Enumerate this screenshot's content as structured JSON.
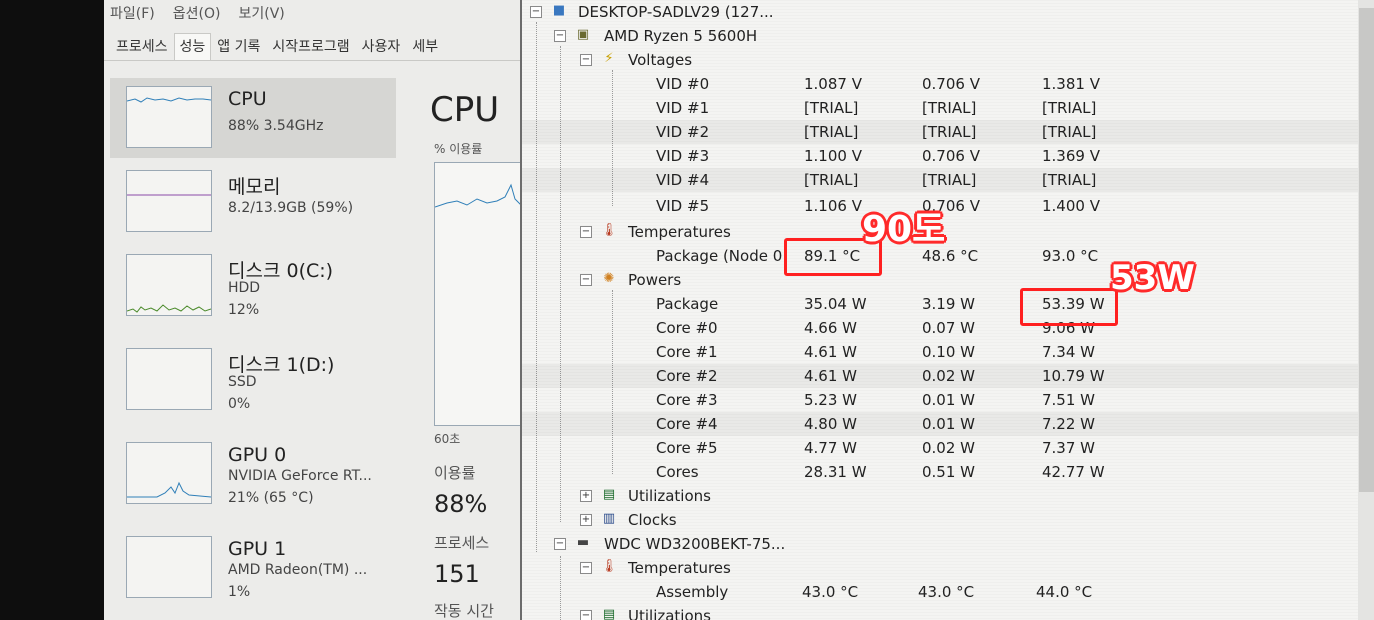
{
  "taskmanager": {
    "menu": [
      "파일(F)",
      "옵션(O)",
      "보기(V)"
    ],
    "tabs": [
      "프로세스",
      "성능",
      "앱 기록",
      "시작프로그램",
      "사용자",
      "세부"
    ],
    "active_tab": "성능",
    "side": [
      {
        "name": "CPU",
        "sub1": "88% 3.54GHz"
      },
      {
        "name": "메모리",
        "sub1": "8.2/13.9GB (59%)"
      },
      {
        "name": "디스크 0(C:)",
        "sub1": "HDD",
        "sub2": "12%"
      },
      {
        "name": "디스크 1(D:)",
        "sub1": "SSD",
        "sub2": "0%"
      },
      {
        "name": "GPU 0",
        "sub1": "NVIDIA GeForce RT...",
        "sub2": "21% (65 °C)"
      },
      {
        "name": "GPU 1",
        "sub1": "AMD Radeon(TM) ...",
        "sub2": "1%"
      }
    ],
    "main": {
      "title": "CPU",
      "usage_label": "% 이용률",
      "time_label": "60초",
      "util_label": "이용률",
      "util_value": "88%",
      "proc_label": "프로세스",
      "proc_value": "151",
      "uptime_label": "작동 시간"
    }
  },
  "hwmonitor": {
    "computer": "DESKTOP-SADLV29 (127...",
    "cpu": "AMD Ryzen 5 5600H",
    "voltages_label": "Voltages",
    "voltages": [
      {
        "name": "VID #0",
        "value": "1.087 V",
        "min": "0.706 V",
        "max": "1.381 V"
      },
      {
        "name": "VID #1",
        "value": "[TRIAL]",
        "min": "[TRIAL]",
        "max": "[TRIAL]"
      },
      {
        "name": "VID #2",
        "value": "[TRIAL]",
        "min": "[TRIAL]",
        "max": "[TRIAL]"
      },
      {
        "name": "VID #3",
        "value": "1.100 V",
        "min": "0.706 V",
        "max": "1.369 V"
      },
      {
        "name": "VID #4",
        "value": "[TRIAL]",
        "min": "[TRIAL]",
        "max": "[TRIAL]"
      },
      {
        "name": "VID #5",
        "value": "1.106 V",
        "min": "0.706 V",
        "max": "1.400 V"
      }
    ],
    "temps_label": "Temperatures",
    "temps": [
      {
        "name": "Package (Node 0",
        "value": "89.1 °C",
        "min": "48.6 °C",
        "max": "93.0 °C"
      }
    ],
    "powers_label": "Powers",
    "powers": [
      {
        "name": "Package",
        "value": "35.04 W",
        "min": "3.19 W",
        "max": "53.39 W"
      },
      {
        "name": "Core #0",
        "value": "4.66 W",
        "min": "0.07 W",
        "max": "9.06 W"
      },
      {
        "name": "Core #1",
        "value": "4.61 W",
        "min": "0.10 W",
        "max": "7.34 W"
      },
      {
        "name": "Core #2",
        "value": "4.61 W",
        "min": "0.02 W",
        "max": "10.79 W"
      },
      {
        "name": "Core #3",
        "value": "5.23 W",
        "min": "0.01 W",
        "max": "7.51 W"
      },
      {
        "name": "Core #4",
        "value": "4.80 W",
        "min": "0.01 W",
        "max": "7.22 W"
      },
      {
        "name": "Core #5",
        "value": "4.77 W",
        "min": "0.02 W",
        "max": "7.37 W"
      },
      {
        "name": "Cores",
        "value": "28.31 W",
        "min": "0.51 W",
        "max": "42.77 W"
      }
    ],
    "utilizations_label": "Utilizations",
    "clocks_label": "Clocks",
    "disk": "WDC WD3200BEKT-75...",
    "disk_temps_label": "Temperatures",
    "disk_temps": [
      {
        "name": "Assembly",
        "value": "43.0 °C",
        "min": "43.0 °C",
        "max": "44.0 °C"
      }
    ],
    "disk_util_label": "Utilizations"
  },
  "annotations": {
    "temp_note": "90도",
    "power_note": "53W",
    "color": "#ff2020"
  }
}
